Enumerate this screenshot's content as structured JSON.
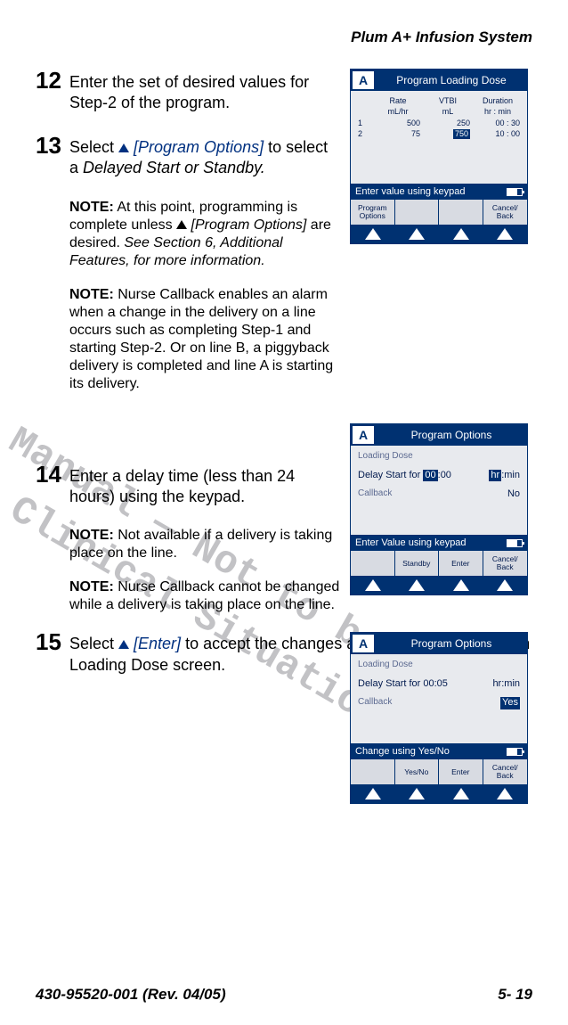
{
  "header": "Plum A+ Infusion System",
  "watermark_line1": "Draft Manual — Not to be used",
  "watermark_line2": "in a Clinical Situation.",
  "steps": {
    "s12": {
      "num": "12",
      "text": "Enter the set of desired values for Step-2 of the program."
    },
    "s13": {
      "num": "13",
      "prefix": "Select ",
      "link": " [Program Options]",
      "suffix1": " to select a ",
      "italic": "Delayed Start or Standby.",
      "note1_b": "NOTE:",
      "note1_t1": "  At this point, programming is complete unless ",
      "note1_link": " [Program Options]",
      "note1_t2": " are desired. ",
      "note1_i": "See Section 6, Additional Features, for more information.",
      "note2_b": "NOTE:",
      "note2_t": " Nurse Callback enables an alarm when a change in the delivery on a line occurs such as completing Step-1 and starting Step-2. Or on line B, a piggyback delivery is completed and line A is starting its delivery."
    },
    "s14": {
      "num": "14",
      "text": "Enter a delay time (less than 24 hours) using the keypad.",
      "note1_b": "NOTE:",
      "note1_t": " Not available if a delivery is taking place on the line.",
      "note2_b": "NOTE:",
      "note2_t": " Nurse Callback cannot be changed while a delivery is taking place on the line."
    },
    "s15": {
      "num": "15",
      "prefix": "Select ",
      "link": " [Enter]",
      "suffix": " to accept the changes and return to the Program Loading Dose screen."
    }
  },
  "screen1": {
    "letter": "A",
    "title": "Program Loading Dose",
    "cols": {
      "c1": "Rate",
      "c2": "VTBI",
      "c3": "Duration"
    },
    "units": {
      "u1": "mL/hr",
      "u2": "mL",
      "u3": "hr : min"
    },
    "rows": [
      {
        "n": "1",
        "rate": "500",
        "vtbi": "250",
        "dur": "00 : 30"
      },
      {
        "n": "2",
        "rate": "75",
        "vtbi": "750",
        "dur": "10 : 00"
      }
    ],
    "status": "Enter value using keypad",
    "keys": [
      "Program\nOptions",
      "",
      "",
      "Cancel/\nBack"
    ]
  },
  "screen2": {
    "letter": "A",
    "title": "Program Options",
    "subtitle": "Loading Dose",
    "delay_label": "Delay Start for",
    "delay_hh": "00",
    "delay_sep": ":",
    "delay_mm": "00",
    "units_hr": "hr",
    "units_sep": ":",
    "units_min": "min",
    "callback_l": "Callback",
    "callback_v": "No",
    "status": "Enter Value using keypad",
    "keys": [
      "",
      "Standby",
      "Enter",
      "Cancel/\nBack"
    ]
  },
  "screen3": {
    "letter": "A",
    "title": "Program Options",
    "subtitle": "Loading Dose",
    "delay_label": "Delay Start for",
    "delay_value": "00:05",
    "units": "hr:min",
    "callback_l": "Callback",
    "callback_v": "Yes",
    "status": "Change using Yes/No",
    "keys": [
      "",
      "Yes/No",
      "Enter",
      "Cancel/\nBack"
    ]
  },
  "footer": {
    "left": "430-95520-001 (Rev. 04/05)",
    "right": "5- 19"
  }
}
